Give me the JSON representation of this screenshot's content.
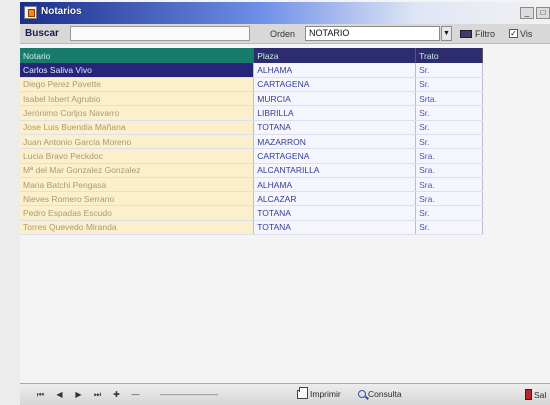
{
  "window": {
    "title": "Notarios"
  },
  "search": {
    "label": "Buscar",
    "value": ""
  },
  "order": {
    "label": "Orden",
    "value": "NOTARIO"
  },
  "filter": {
    "label": "Filtro"
  },
  "view_check": {
    "label": "Vis",
    "checked": true
  },
  "grid": {
    "columns": [
      "Notario",
      "Plaza",
      "Trato"
    ],
    "selected_row": 0,
    "rows": [
      [
        "Carlos Saliva Vivo",
        "ALHAMA",
        "Sr."
      ],
      [
        "Diego Perez Pavette",
        "CARTAGENA",
        "Sr."
      ],
      [
        "Isabel Isbert Agrubio",
        "MURCIA",
        "Srta."
      ],
      [
        "Jerónimo Corljos Navarro",
        "LIBRILLA",
        "Sr."
      ],
      [
        "Jose Luis Buendia Mañana",
        "TOTANA",
        "Sr."
      ],
      [
        "Juan Antonio García Moreno",
        "MAZARRON",
        "Sr."
      ],
      [
        "Lucia Bravo Peckdoc",
        "CARTAGENA",
        "Sra."
      ],
      [
        "Mª del Mar Gonzalez Gonzalez",
        "ALCANTARILLA",
        "Sra."
      ],
      [
        "Maria Batchi Pengasa",
        "ALHAMA",
        "Sra."
      ],
      [
        "Nieves Romero Serrano",
        "ALCAZAR",
        "Sra."
      ],
      [
        "Pedro Espadas Escudo",
        "TOTANA",
        "Sr."
      ],
      [
        "Torres Quevedo Miranda",
        "TOTANA",
        "Sr."
      ]
    ]
  },
  "toolbar": {
    "nav": [
      "⏮",
      "◀",
      "▶",
      "⏭",
      "✚",
      "—"
    ],
    "print_label": "Imprimir",
    "consult_label": "Consulta",
    "exit_label": "Sal"
  }
}
